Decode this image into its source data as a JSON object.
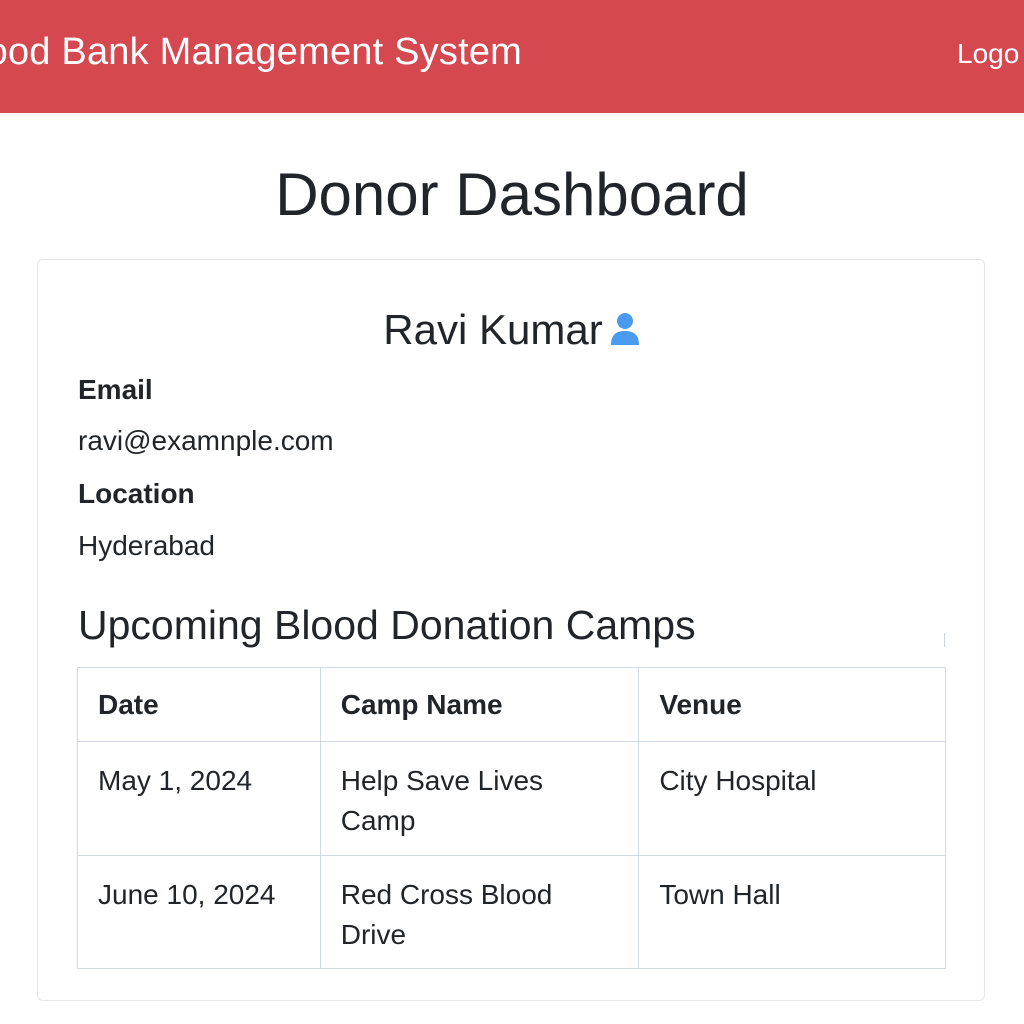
{
  "navbar": {
    "brand": "lood Bank Management System",
    "logout_label": "Logo"
  },
  "page": {
    "title": "Donor Dashboard"
  },
  "profile": {
    "name": "Ravi Kumar",
    "icon": "user-icon",
    "email_label": "Email",
    "email_value": "ravi@examnple.com",
    "location_label": "Location",
    "location_value": "Hyderabad"
  },
  "camps": {
    "title": "Upcoming Blood Donation Camps",
    "columns": [
      "Date",
      "Camp Name",
      "Venue"
    ],
    "rows": [
      [
        "May 1, 2024",
        "Help Save Lives Camp",
        "City Hospital"
      ],
      [
        "June 10, 2024",
        "Red Cross Blood Drive",
        "Town Hall"
      ]
    ]
  },
  "colors": {
    "navbar_bg": "#d5484f",
    "icon_blue": "#4a9bf0"
  }
}
